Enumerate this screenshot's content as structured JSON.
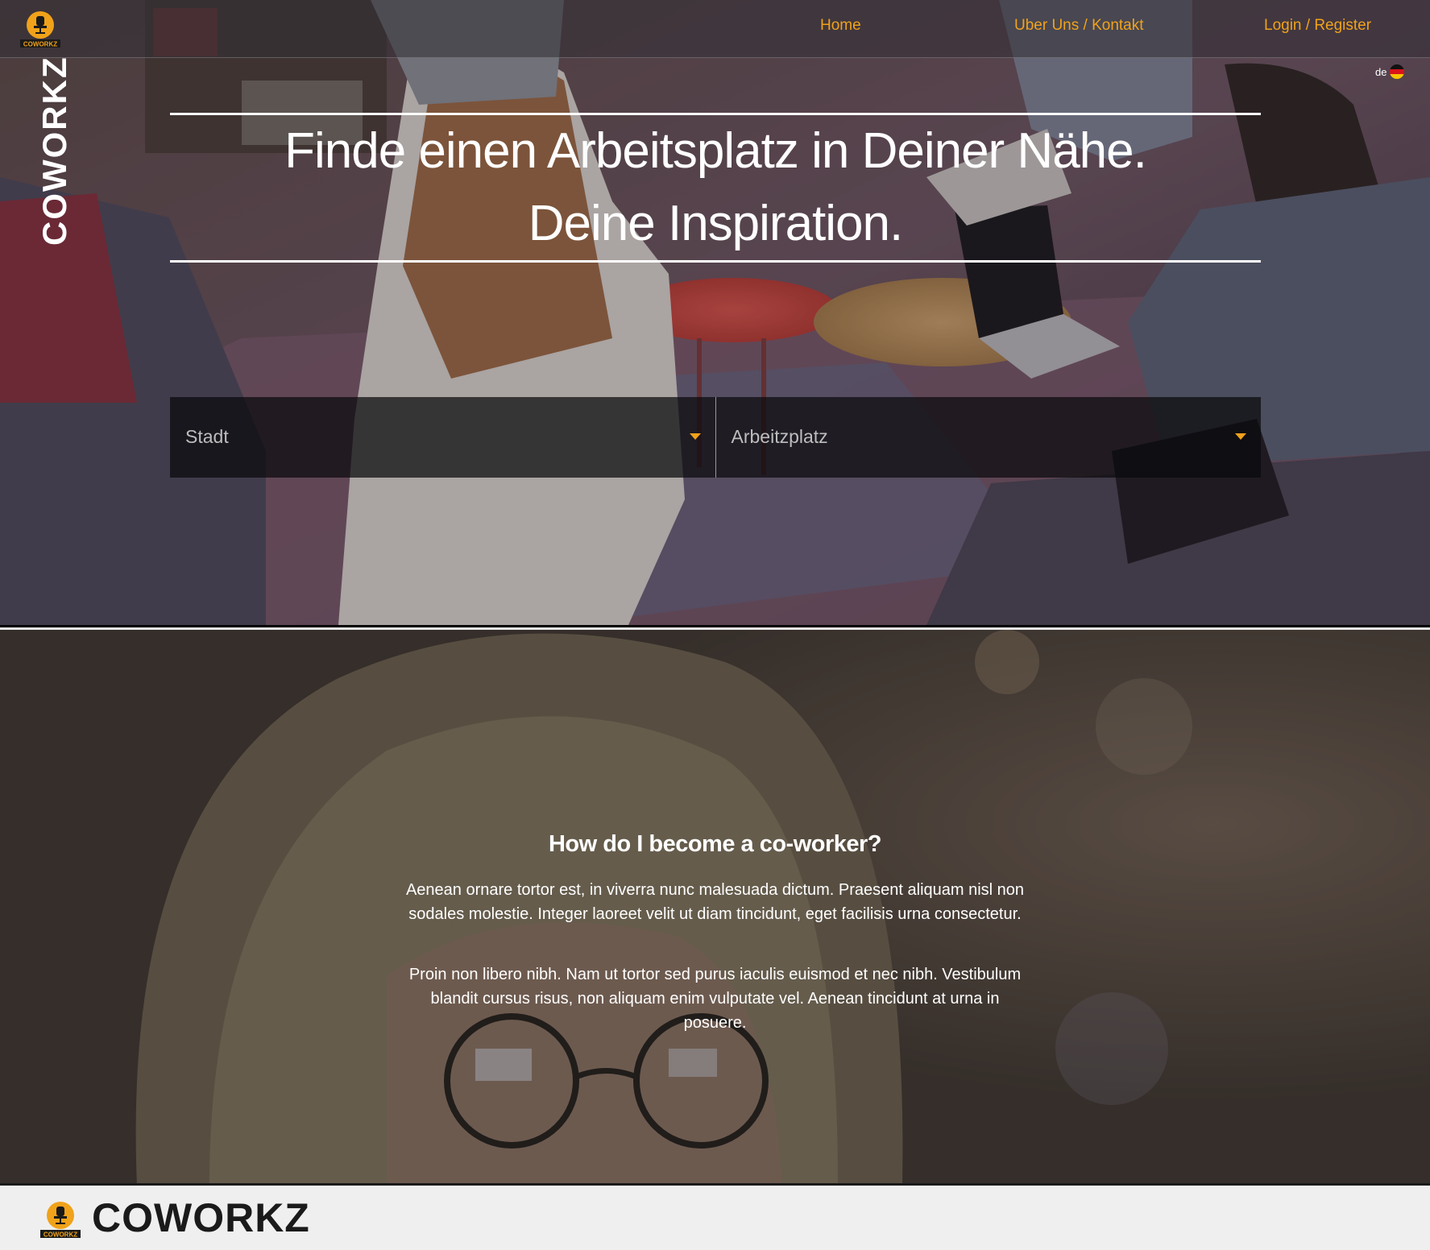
{
  "brand": {
    "name": "COWORKZ",
    "logo_text": "COWORKZ"
  },
  "nav": {
    "links": [
      {
        "label": "Home"
      },
      {
        "label": "Uber Uns / Kontakt"
      },
      {
        "label": "Login / Register"
      }
    ]
  },
  "language": {
    "code": "de",
    "flag": "germany-flag-icon"
  },
  "hero": {
    "title_line1": "Finde einen Arbeitsplatz in Deiner Nähe.",
    "title_line2": "Deine Inspiration.",
    "search": {
      "city_placeholder": "Stadt",
      "workplace_placeholder": "Arbeitzplatz"
    }
  },
  "info": {
    "title": "How do I become a co-worker?",
    "paragraph1": "Aenean ornare tortor est, in viverra nunc malesuada dictum. Praesent aliquam nisl non sodales molestie. Integer laoreet velit ut diam tincidunt, eget facilisis urna consectetur.",
    "paragraph2": "Proin non libero nibh. Nam ut tortor sed purus iaculis euismod et nec nibh. Vestibulum blandit cursus risus, non aliquam enim vulputate vel. Aenean tincidunt at urna in posuere."
  },
  "footer": {
    "brand": "COWORKZ"
  },
  "colors": {
    "accent": "#f0a21a",
    "footer_bg": "#efefef",
    "text_light": "#ffffff",
    "footer_text": "#1a1a1a"
  }
}
